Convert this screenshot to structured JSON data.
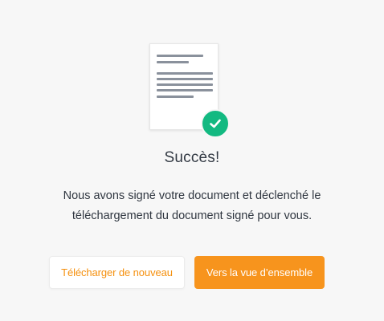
{
  "illustration": {
    "icon": "signed-document-icon",
    "badge_icon": "checkmark-icon",
    "badge_color": "#13b981"
  },
  "title": "Succès!",
  "message": "Nous avons signé votre document et déclenché le téléchargement du document signé pour vous.",
  "actions": {
    "download_again_label": "Télécharger de nouveau",
    "overview_label": "Vers la vue d’ensemble"
  },
  "colors": {
    "accent": "#f7941d",
    "background": "#f7f7f7",
    "text": "#333a44"
  }
}
